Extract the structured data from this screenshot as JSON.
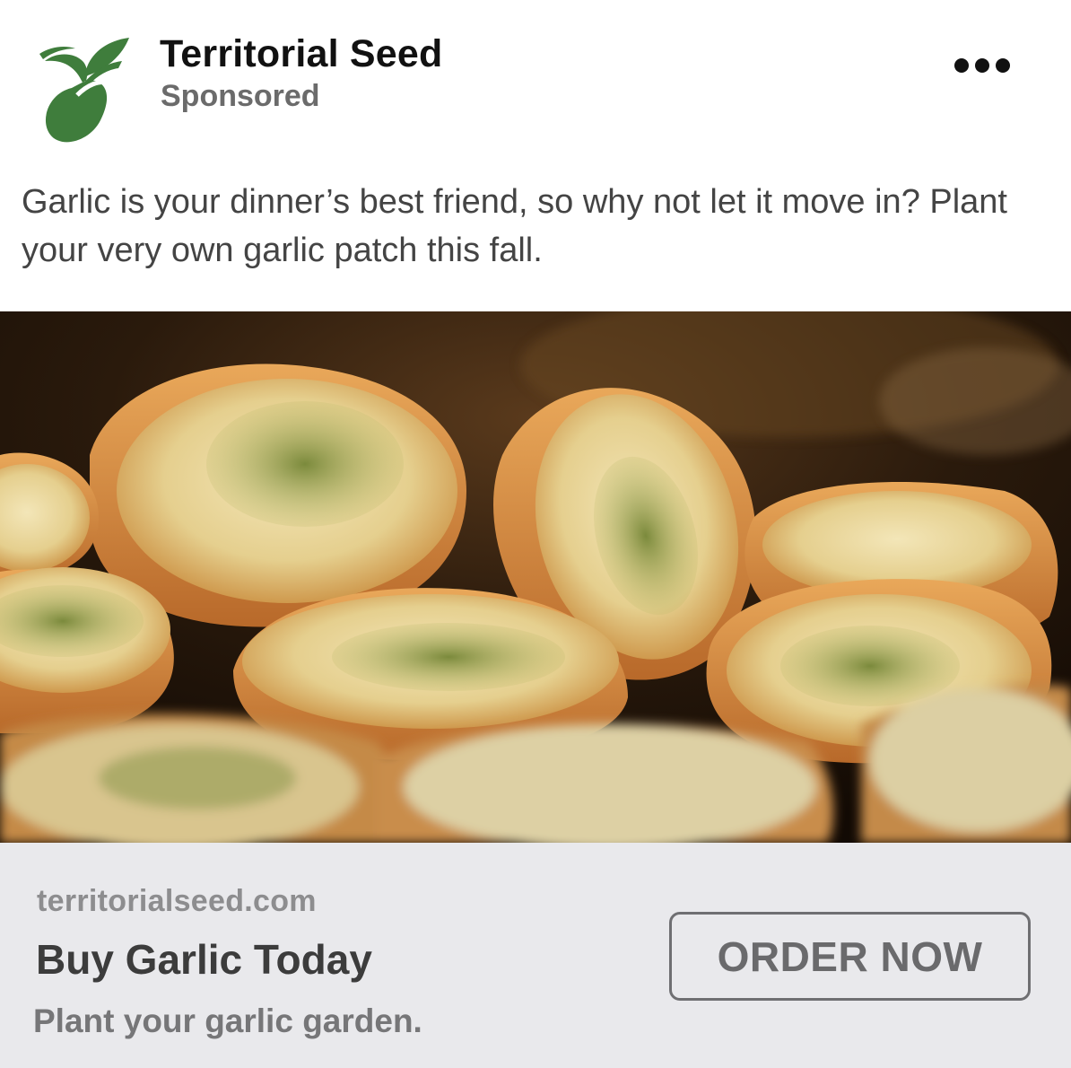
{
  "ad": {
    "advertiser": "Territorial Seed",
    "sponsored_label": "Sponsored",
    "more_icon": "more-horizontal-icon",
    "logo_icon": "seed-sprout-logo",
    "primary_text": "Garlic is your dinner’s best friend, so why not let it move in? Plant your very own garlic patch this fall.",
    "image_subject": "garlic-bread-photo",
    "domain": "territorialseed.com",
    "headline": "Buy Garlic Today",
    "description": "Plant your garlic garden.",
    "cta_label": "ORDER NOW",
    "brand_color": "#3f7d3c"
  }
}
